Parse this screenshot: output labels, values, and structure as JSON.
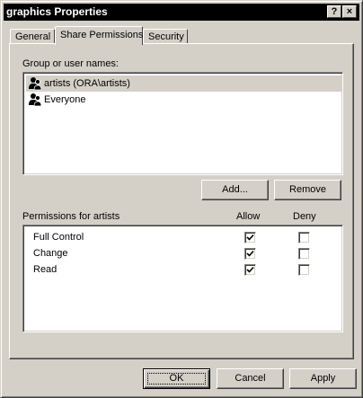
{
  "window": {
    "title": "graphics Properties",
    "help_glyph": "?",
    "close_glyph": "×"
  },
  "tabs": [
    {
      "label": "General",
      "active": false
    },
    {
      "label": "Share Permissions",
      "active": true
    },
    {
      "label": "Security",
      "active": false
    }
  ],
  "groups": {
    "label": "Group or user names:",
    "items": [
      {
        "name": "artists (ORA\\artists)",
        "icon": "users-icon",
        "selected": true
      },
      {
        "name": "Everyone",
        "icon": "users-icon",
        "selected": false
      }
    ],
    "add_button": "Add...",
    "remove_button": "Remove"
  },
  "permissions": {
    "label": "Permissions for artists",
    "allow_header": "Allow",
    "deny_header": "Deny",
    "rows": [
      {
        "name": "Full Control",
        "allow": true,
        "deny": false
      },
      {
        "name": "Change",
        "allow": true,
        "deny": false
      },
      {
        "name": "Read",
        "allow": true,
        "deny": false
      }
    ]
  },
  "footer": {
    "ok": "OK",
    "cancel": "Cancel",
    "apply": "Apply"
  }
}
